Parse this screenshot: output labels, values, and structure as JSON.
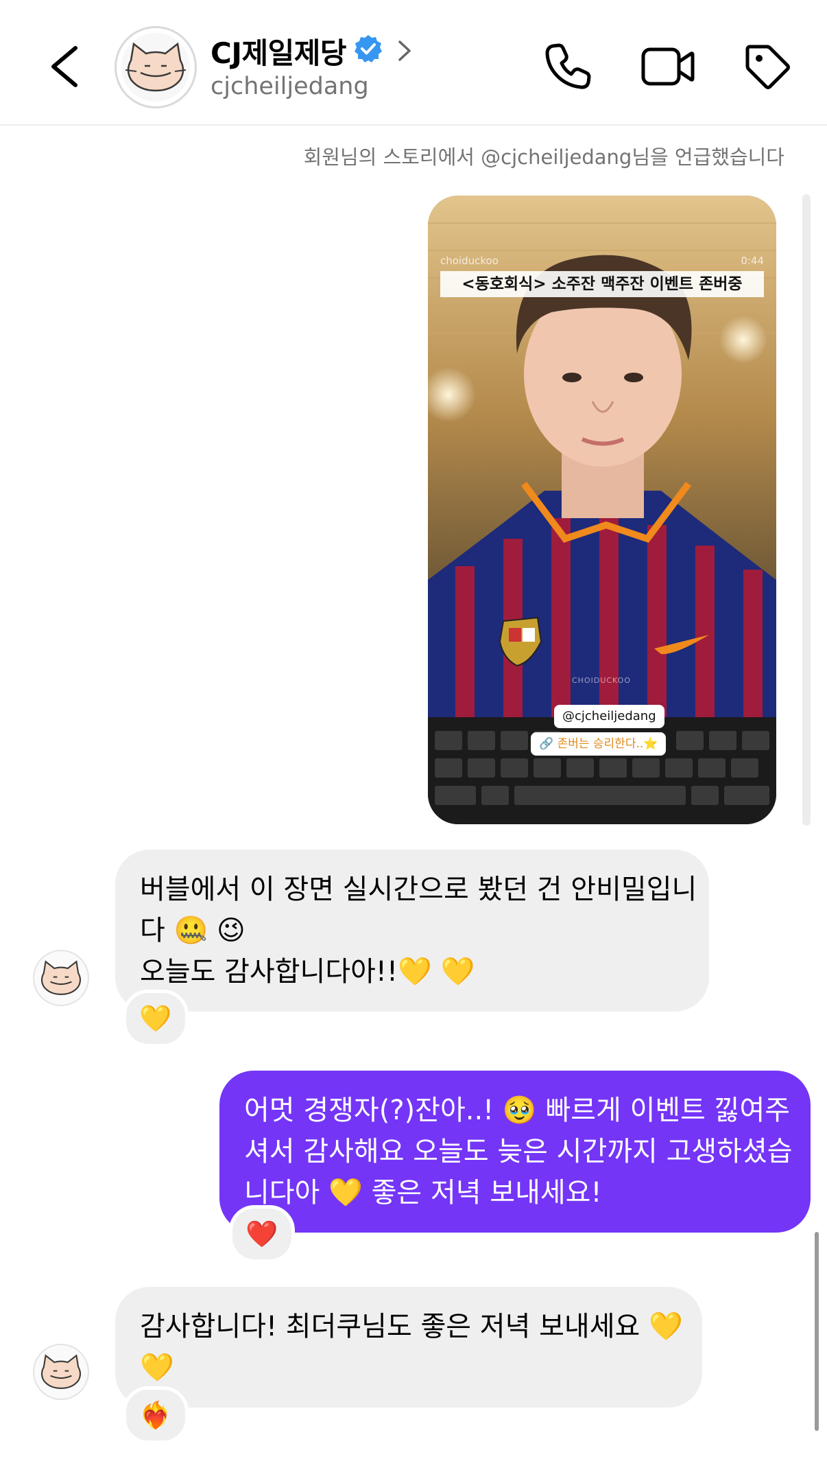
{
  "header": {
    "profile_name": "CJ제일제당",
    "profile_handle": "cjcheiljedang",
    "verified": true
  },
  "thread": {
    "story_mention_text": "회원님의 스토리에서 @cjcheiljedang님을 언급했습니다",
    "story": {
      "watermark": "choiduckoo",
      "timestamp": "0:44",
      "caption": "<동호회식> 소주잔 맥주잔 이벤트 존버중",
      "mention_sticker": "@cjcheiljedang",
      "link_sticker": "존버는 승리한다..⭐",
      "shirt_text": "CHOIDUCKOO"
    },
    "messages": [
      {
        "direction": "incoming",
        "lines": [
          "버블에서 이 장면 실시간으로 봤던 건 안비밀입니",
          "다 🤐 😉",
          "오늘도 감사합니다아!!💛 💛"
        ],
        "reaction": "💛"
      },
      {
        "direction": "outgoing",
        "lines": [
          "어멋 경쟁자(?)잔아..! 🥹 빠르게 이벤트 낋여주",
          "셔서 감사해요 오늘도 늦은 시간까지 고생하셨습",
          "니다아 💛 좋은 저녁 보내세요!"
        ],
        "reaction": "❤️"
      },
      {
        "direction": "incoming",
        "lines": [
          "감사합니다! 최더쿠님도 좋은 저녁 보내세요 💛",
          "💛"
        ],
        "reaction": "❤️‍🔥"
      }
    ]
  },
  "colors": {
    "outgoing_bubble": "#7435f7",
    "incoming_bubble": "#efefef",
    "verified_badge": "#3797f0",
    "muted_text": "#737373"
  },
  "icons": [
    "back-arrow-icon",
    "verified-badge-icon",
    "chevron-right-icon",
    "phone-icon",
    "video-camera-icon",
    "tag-icon"
  ]
}
